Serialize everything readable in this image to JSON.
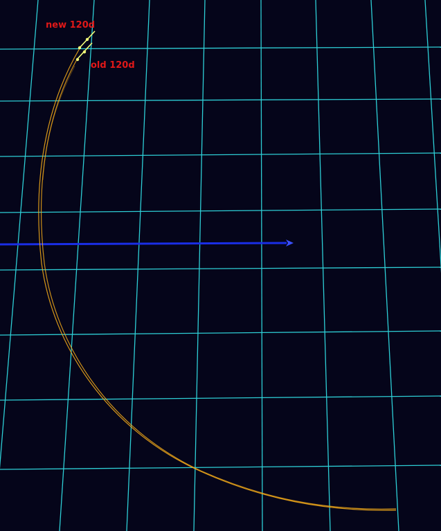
{
  "labels": {
    "new": "new 120d",
    "old": "old 120d"
  },
  "colors": {
    "background": "#05051a",
    "grid": "#2ecfd6",
    "orbit_trajectory": "#f0a81a",
    "direction_axis": "#1a2ee6",
    "label_text": "#e01818",
    "marker": "#f4ff7a"
  },
  "icons": {
    "direction_arrow": "arrow-right-icon"
  }
}
